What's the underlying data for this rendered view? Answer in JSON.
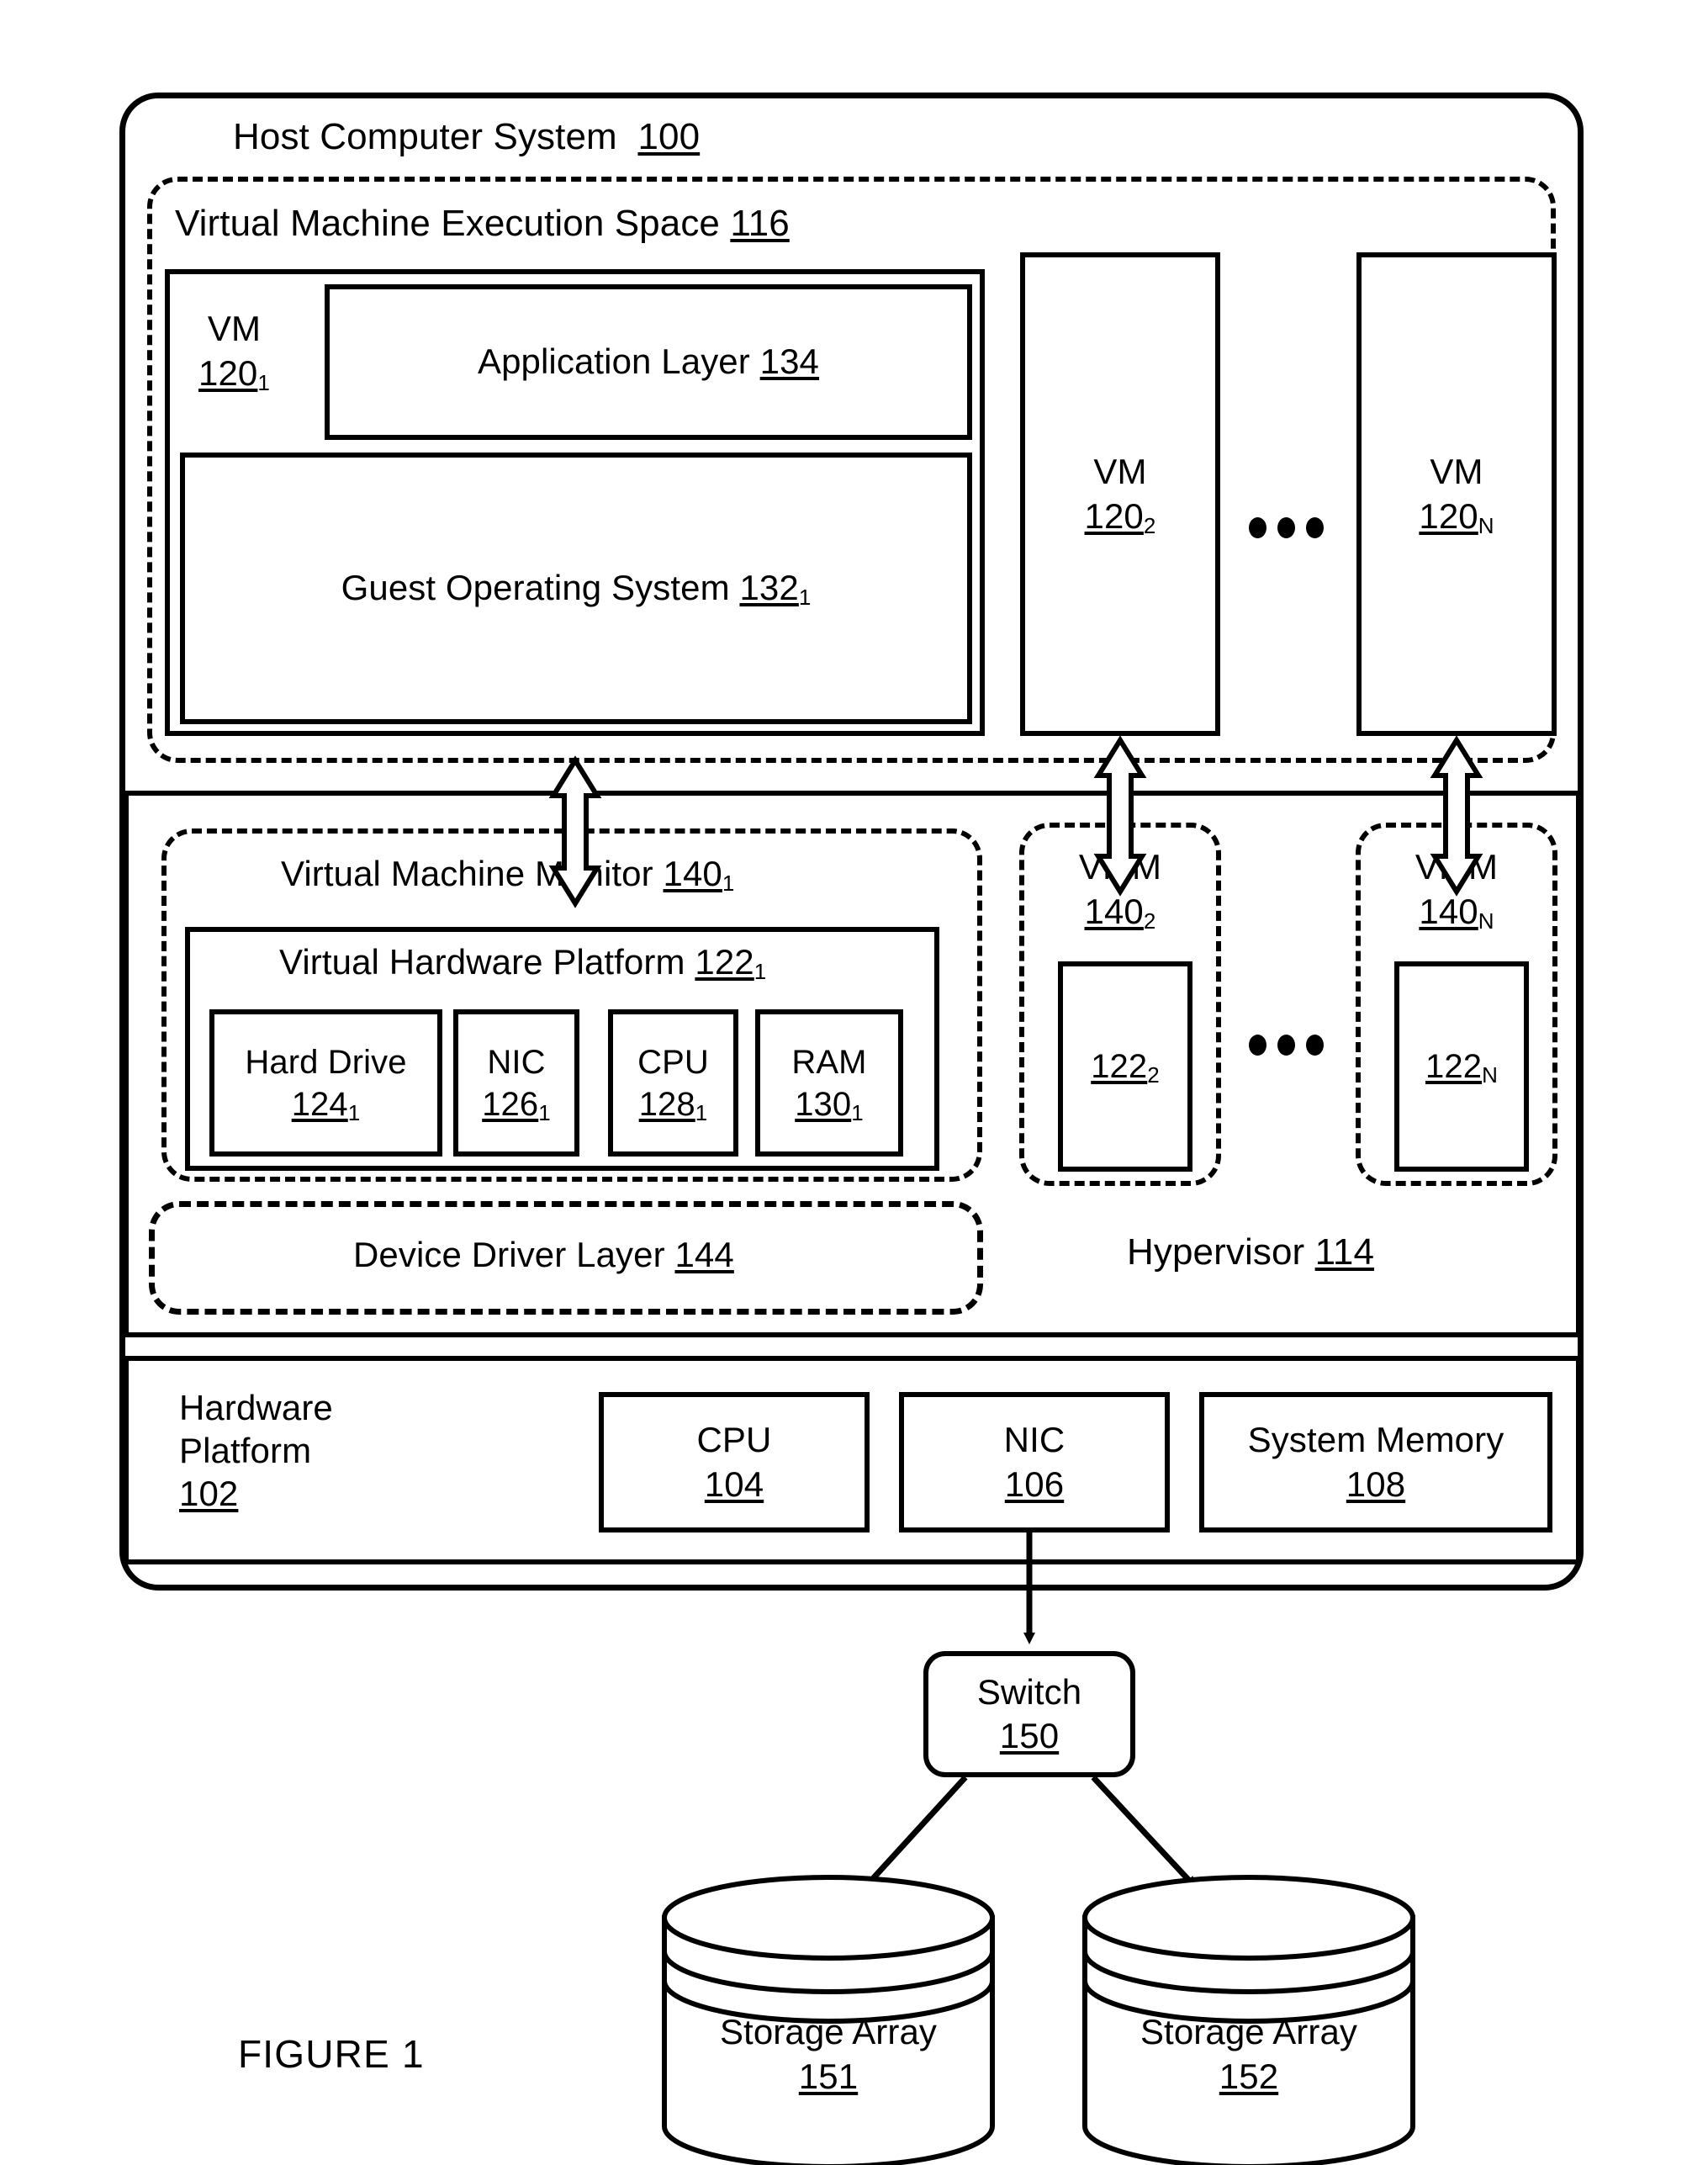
{
  "figure": {
    "caption": "FIGURE 1"
  },
  "host": {
    "title": "Host Computer System",
    "ref": "100"
  },
  "vm_execution_space": {
    "title": "Virtual Machine Execution Space",
    "ref": "116",
    "vm1": {
      "label": "VM",
      "ref": "120",
      "sub": "1",
      "application_layer": {
        "label": "Application Layer",
        "ref": "134"
      },
      "guest_os": {
        "label": "Guest Operating System",
        "ref": "132",
        "sub": "1"
      }
    },
    "vm2": {
      "label": "VM",
      "ref": "120",
      "sub": "2"
    },
    "vmN": {
      "label": "VM",
      "ref": "120",
      "sub": "N"
    },
    "ellipsis": "•••"
  },
  "hypervisor": {
    "label": "Hypervisor",
    "ref": "114",
    "vmm1": {
      "title": "Virtual Machine Monitor",
      "ref": "140",
      "sub": "1",
      "virtual_hardware_platform": {
        "title": "Virtual Hardware Platform",
        "ref": "122",
        "sub": "1",
        "devices": [
          {
            "label": "Hard Drive",
            "ref": "124",
            "sub": "1"
          },
          {
            "label": "NIC",
            "ref": "126",
            "sub": "1"
          },
          {
            "label": "CPU",
            "ref": "128",
            "sub": "1"
          },
          {
            "label": "RAM",
            "ref": "130",
            "sub": "1"
          }
        ]
      }
    },
    "vmm2": {
      "label": "VMM",
      "ref": "140",
      "sub": "2",
      "platform_ref": "122",
      "platform_sub": "2"
    },
    "vmmN": {
      "label": "VMM",
      "ref": "140",
      "sub": "N",
      "platform_ref": "122",
      "platform_sub": "N"
    },
    "ellipsis": "•••",
    "device_driver_layer": {
      "label": "Device Driver Layer",
      "ref": "144"
    }
  },
  "hardware_platform": {
    "label_line1": "Hardware",
    "label_line2": "Platform",
    "ref": "102",
    "components": [
      {
        "label": "CPU",
        "ref": "104"
      },
      {
        "label": "NIC",
        "ref": "106"
      },
      {
        "label": "System Memory",
        "ref": "108"
      }
    ]
  },
  "switch": {
    "label": "Switch",
    "ref": "150"
  },
  "storage_arrays": [
    {
      "label": "Storage Array",
      "ref": "151"
    },
    {
      "label": "Storage Array",
      "ref": "152"
    }
  ]
}
